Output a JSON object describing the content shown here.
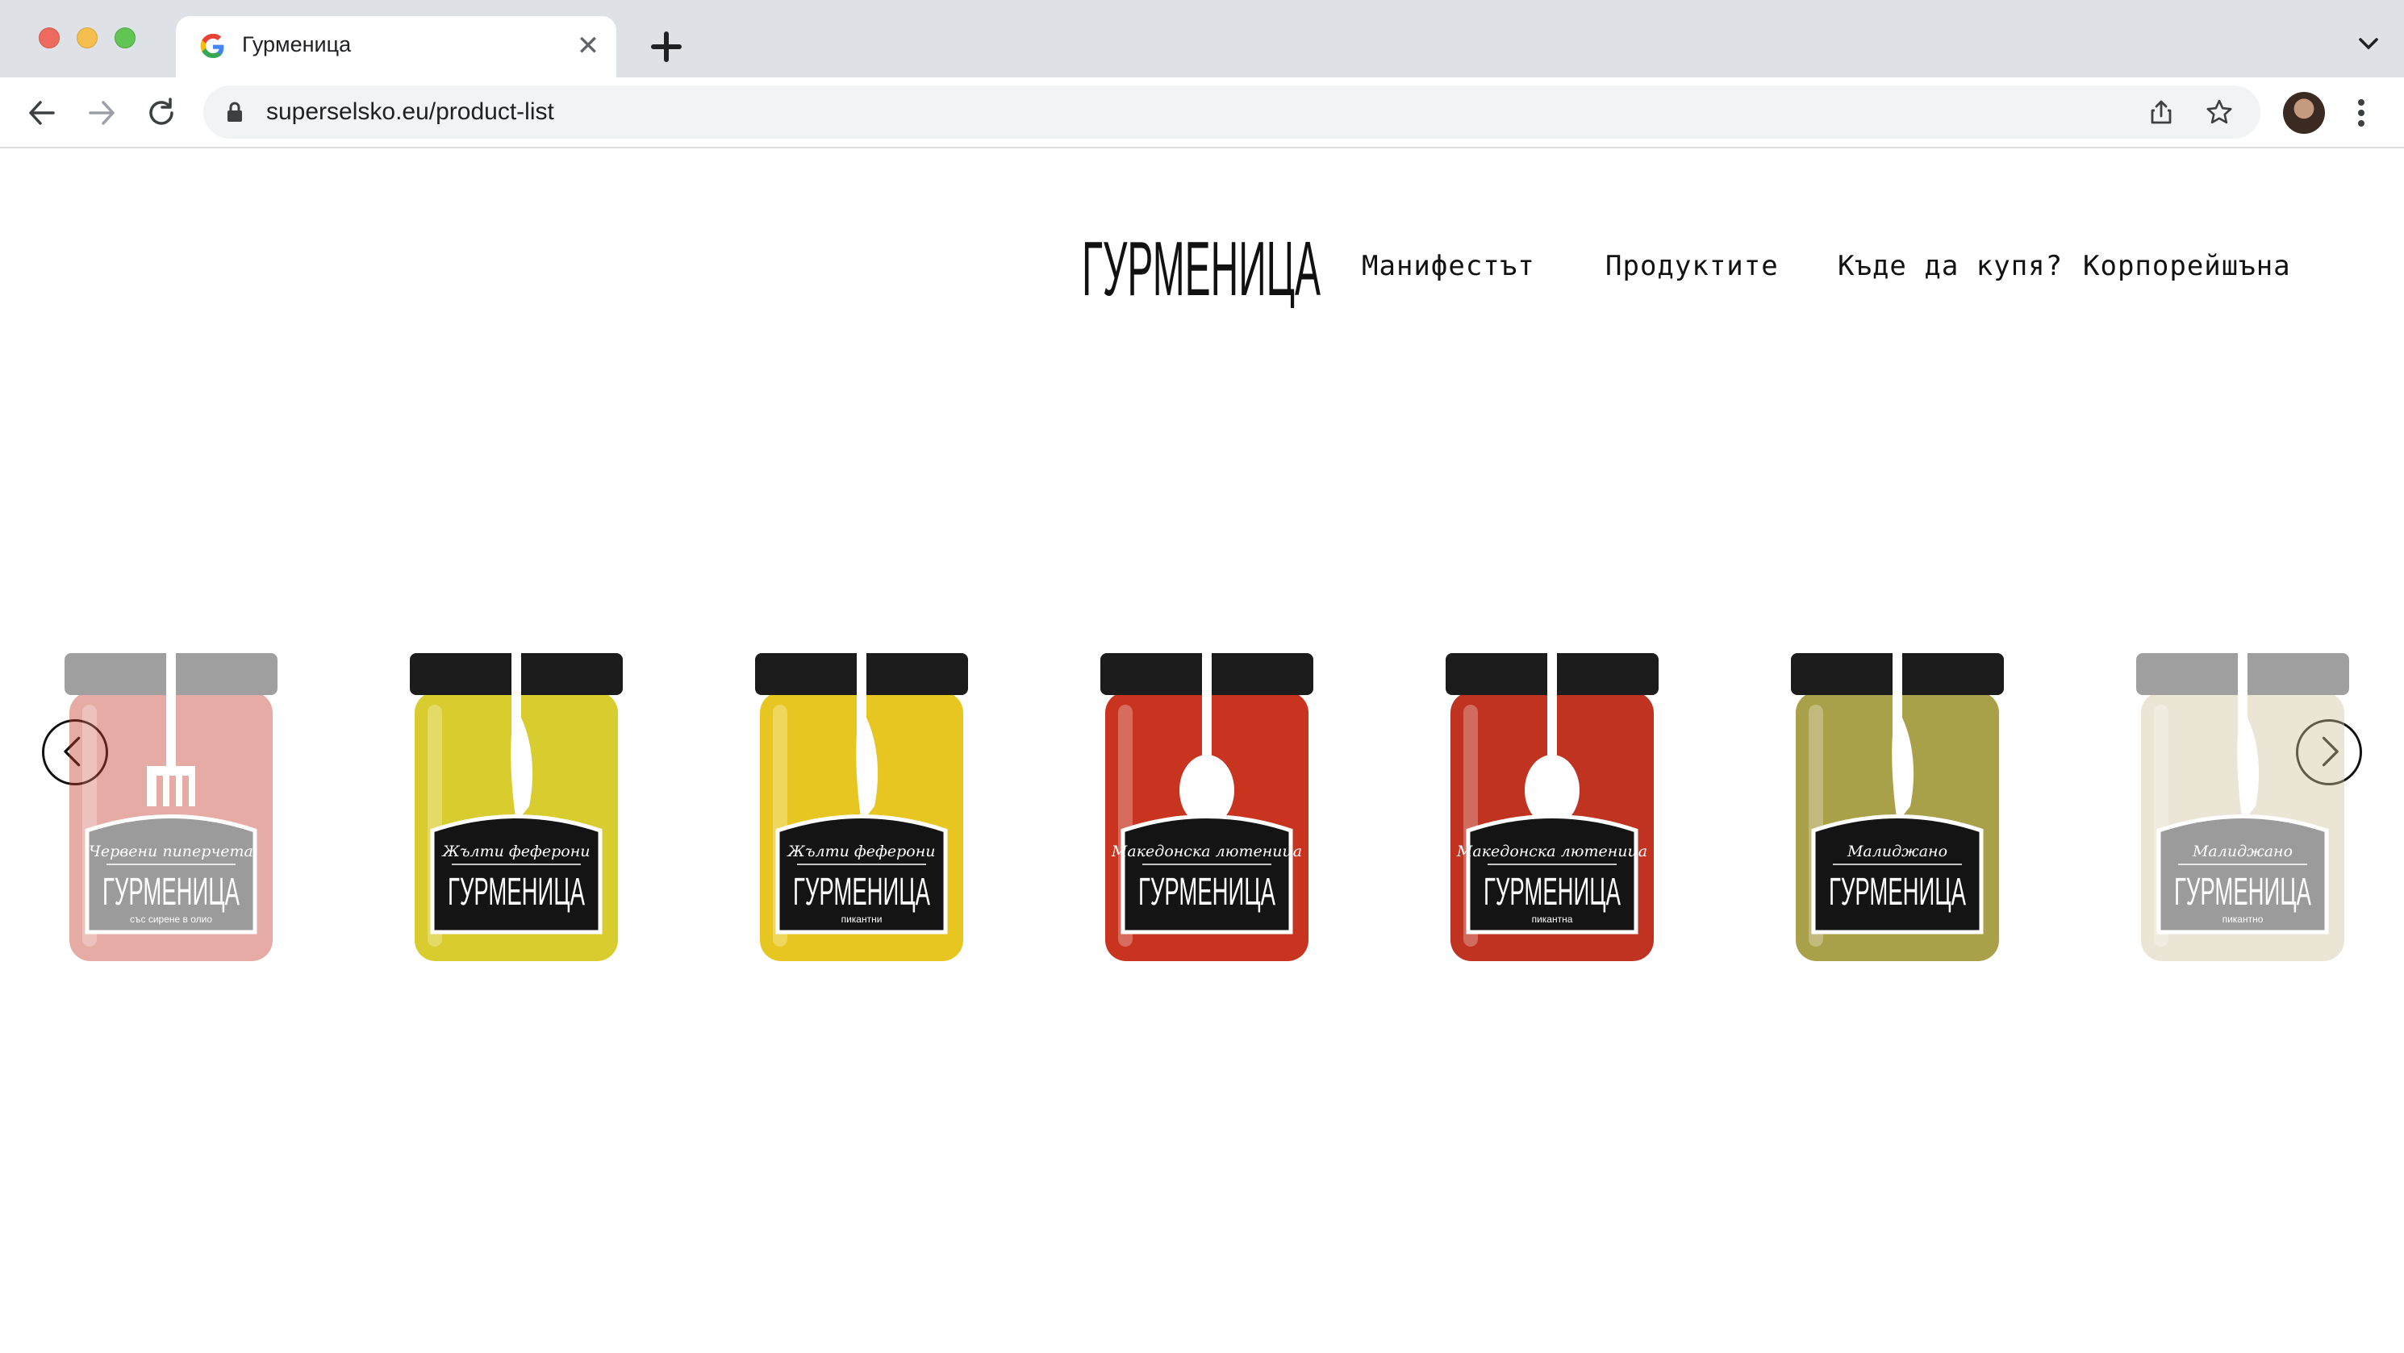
{
  "browser": {
    "tab_title": "Гурменица",
    "tab_close_label": "✕",
    "url": "superselsko.eu/product-list",
    "icons": [
      "google-favicon",
      "close-icon",
      "plus-icon",
      "chevron-down-icon",
      "back-arrow-icon",
      "forward-arrow-icon",
      "reload-icon",
      "lock-icon",
      "share-icon",
      "star-icon",
      "avatar",
      "kebab-menu-icon"
    ]
  },
  "site": {
    "logo_text": "ГУРМЕНИЦА",
    "nav": [
      "Манифестът",
      "Продуктите",
      "Къде да купя?",
      "Корпорейшъна"
    ]
  },
  "carousel": {
    "prev_icon": "chevron-left-icon",
    "next_icon": "chevron-right-icon",
    "products": [
      {
        "title": "Червени пиперчета",
        "brand": "ГУРМЕНИЦА",
        "sub": "със сирене в олио",
        "utensil": "fork",
        "fill": "#c73a2b",
        "faded": true
      },
      {
        "title": "Жълти феферони",
        "brand": "ГУРМЕНИЦА",
        "sub": "",
        "utensil": "knife",
        "fill": "#d8cc2e",
        "faded": false
      },
      {
        "title": "Жълти феферони",
        "brand": "ГУРМЕНИЦА",
        "sub": "пикантни",
        "utensil": "knife",
        "fill": "#e8c622",
        "faded": false
      },
      {
        "title": "Македонска лютеница",
        "brand": "ГУРМЕНИЦА",
        "sub": "",
        "utensil": "spoon",
        "fill": "#c8341f",
        "faded": false
      },
      {
        "title": "Македонска лютеница",
        "brand": "ГУРМЕНИЦА",
        "sub": "пикантна",
        "utensil": "spoon",
        "fill": "#bf3320",
        "faded": false
      },
      {
        "title": "Малиджано",
        "brand": "ГУРМЕНИЦА",
        "sub": "",
        "utensil": "knife",
        "fill": "#a9a04a",
        "faded": false
      },
      {
        "title": "Малиджано",
        "brand": "ГУРМЕНИЦА",
        "sub": "пикантно",
        "utensil": "knife",
        "fill": "#cfc39a",
        "faded": true
      }
    ]
  }
}
